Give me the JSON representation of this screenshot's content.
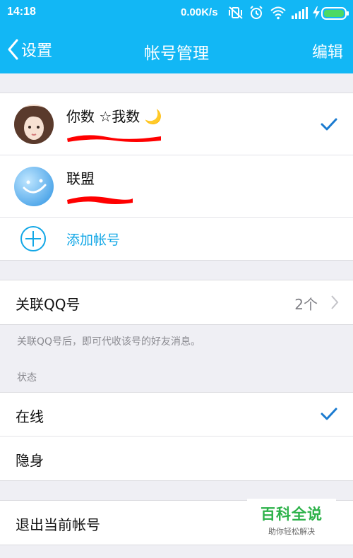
{
  "status_bar": {
    "time": "14:18",
    "net_speed": "0.00K/s",
    "icons": [
      "vibrate-off-icon",
      "alarm-icon",
      "wifi-icon",
      "signal-icon",
      "charging-icon",
      "battery-icon"
    ]
  },
  "nav": {
    "back_label": "设置",
    "title": "帐号管理",
    "edit_label": "编辑"
  },
  "accounts": [
    {
      "name": "你数 ☆我数 🌙",
      "selected": true
    },
    {
      "name": "联盟",
      "selected": false
    }
  ],
  "add_account_label": "添加帐号",
  "linked_qq": {
    "label": "关联QQ号",
    "value": "2个",
    "note": "关联QQ号后，即可代收该号的好友消息。"
  },
  "status_section": {
    "header": "状态",
    "options": [
      {
        "label": "在线",
        "selected": true
      },
      {
        "label": "隐身",
        "selected": false
      }
    ]
  },
  "logout_label": "退出当前帐号",
  "watermark": {
    "title": "百科全说",
    "subtitle": "助你轻松解决"
  },
  "colors": {
    "accent": "#12b7f5",
    "link": "#12a7e6",
    "check": "#1b7bd0",
    "redaction": "#ff0000",
    "watermark_green": "#2db24a"
  }
}
